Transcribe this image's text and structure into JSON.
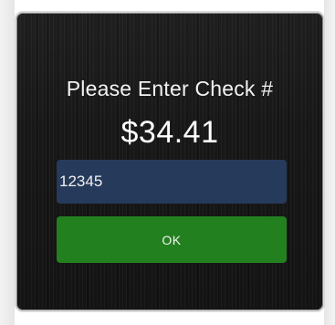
{
  "dialog": {
    "title": "Please Enter Check #",
    "amount": "$34.41",
    "check_input": {
      "value": "12345",
      "placeholder": ""
    },
    "ok_label": "OK"
  },
  "colors": {
    "dialog_background": "#181818",
    "input_background": "#263b5b",
    "ok_button": "#23801f",
    "text": "#ffffff",
    "dialog_border": "#d9d9d9"
  }
}
